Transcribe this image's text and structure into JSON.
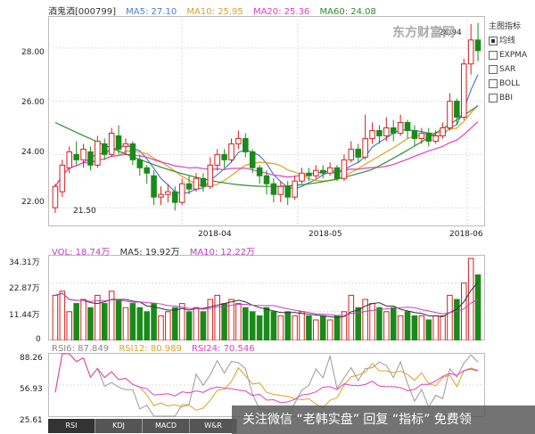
{
  "header": {
    "stock_name": "酒鬼酒[000799]",
    "ma5": "MA5: 27.10",
    "ma10": "MA10: 25.95",
    "ma20": "MA20: 25.36",
    "ma60": "MA60: 24.08"
  },
  "colors": {
    "ma5": "#4a7bd6",
    "ma10": "#e0a020",
    "ma20": "#e040c0",
    "ma60": "#2e8b2e",
    "up": "#d42020",
    "down": "#1a8a1a"
  },
  "price_axis": [
    "28.00",
    "26.00",
    "24.00",
    "22.00"
  ],
  "price_annotations": {
    "high": "28.94",
    "low": "21.50"
  },
  "dates": [
    "2018-04",
    "2018-05",
    "2018-06"
  ],
  "side_menu": {
    "title": "主图指标",
    "items": [
      {
        "label": "均线",
        "checked": true
      },
      {
        "label": "EXPMA",
        "checked": false
      },
      {
        "label": "SAR",
        "checked": false
      },
      {
        "label": "BOLL",
        "checked": false
      },
      {
        "label": "BBI",
        "checked": false
      }
    ]
  },
  "volume": {
    "vol": "VOL: 18.74万",
    "ma5": "MA5: 19.92万",
    "ma10": "MA10: 12.22万",
    "axis": [
      "34.31万",
      "22.87万",
      "11.44万",
      "0"
    ]
  },
  "rsi": {
    "rsi6": "RSI6: 87.849",
    "rsi12": "RSI12: 80.989",
    "rsi24": "RSI24: 70.546",
    "axis": [
      "88.26",
      "56.93",
      "25.61"
    ]
  },
  "tabs": [
    "RSI",
    "KDJ",
    "MACD",
    "W&R"
  ],
  "watermark": {
    "text": "关注微信 “老韩实盘” 回复 “指标” 免费领",
    "logo": "东方财富网"
  },
  "chart_data": {
    "type": "candlestick",
    "candles": [
      [
        22.0,
        22.8,
        21.8,
        22.9
      ],
      [
        22.6,
        23.6,
        22.4,
        23.8
      ],
      [
        23.5,
        24.1,
        23.3,
        24.3
      ],
      [
        24.0,
        23.8,
        23.6,
        24.5
      ],
      [
        23.8,
        24.2,
        23.5,
        24.4
      ],
      [
        24.1,
        23.6,
        23.4,
        24.3
      ],
      [
        23.6,
        24.5,
        23.5,
        24.7
      ],
      [
        24.4,
        24.0,
        23.8,
        24.6
      ],
      [
        24.0,
        24.8,
        23.9,
        25.0
      ],
      [
        24.7,
        24.2,
        24.0,
        25.1
      ],
      [
        24.3,
        24.4,
        24.0,
        24.6
      ],
      [
        24.4,
        23.8,
        23.6,
        24.5
      ],
      [
        23.8,
        23.5,
        23.2,
        24.0
      ],
      [
        23.5,
        23.3,
        22.9,
        23.6
      ],
      [
        23.2,
        22.4,
        22.1,
        23.4
      ],
      [
        22.4,
        22.5,
        22.1,
        22.8
      ],
      [
        22.5,
        22.6,
        22.2,
        22.9
      ],
      [
        22.6,
        22.2,
        21.9,
        22.8
      ],
      [
        22.2,
        22.9,
        22.1,
        23.1
      ],
      [
        22.9,
        22.7,
        22.5,
        23.2
      ],
      [
        22.7,
        23.1,
        22.6,
        23.3
      ],
      [
        23.1,
        22.8,
        22.6,
        23.3
      ],
      [
        22.8,
        23.6,
        22.7,
        23.9
      ],
      [
        23.6,
        24.0,
        23.4,
        24.2
      ],
      [
        24.0,
        23.8,
        23.5,
        24.2
      ],
      [
        23.8,
        24.4,
        23.7,
        24.6
      ],
      [
        24.4,
        24.6,
        24.2,
        24.9
      ],
      [
        24.6,
        24.1,
        23.9,
        24.8
      ],
      [
        24.1,
        23.5,
        23.3,
        24.2
      ],
      [
        23.5,
        23.2,
        22.9,
        23.6
      ],
      [
        23.2,
        22.9,
        22.5,
        23.4
      ],
      [
        22.9,
        22.5,
        22.2,
        23.1
      ],
      [
        22.5,
        22.8,
        22.2,
        23.0
      ],
      [
        22.8,
        22.4,
        22.1,
        23.0
      ],
      [
        22.4,
        23.0,
        22.3,
        23.2
      ],
      [
        23.0,
        23.3,
        22.9,
        23.5
      ],
      [
        23.3,
        23.2,
        23.0,
        23.5
      ],
      [
        23.2,
        23.4,
        23.1,
        23.6
      ],
      [
        23.4,
        23.3,
        23.1,
        23.6
      ],
      [
        23.3,
        23.5,
        23.2,
        23.7
      ],
      [
        23.5,
        23.1,
        23.0,
        23.6
      ],
      [
        23.1,
        23.8,
        23.0,
        24.0
      ],
      [
        23.8,
        24.2,
        23.7,
        24.5
      ],
      [
        24.2,
        23.9,
        23.7,
        24.4
      ],
      [
        23.9,
        24.6,
        23.8,
        25.5
      ],
      [
        24.6,
        24.9,
        24.4,
        25.2
      ],
      [
        24.9,
        24.7,
        24.4,
        25.1
      ],
      [
        24.7,
        25.0,
        24.5,
        25.4
      ],
      [
        25.0,
        24.8,
        24.5,
        25.3
      ],
      [
        24.8,
        25.2,
        24.7,
        25.5
      ],
      [
        25.2,
        24.9,
        24.6,
        25.3
      ],
      [
        24.9,
        24.6,
        24.3,
        25.1
      ],
      [
        24.6,
        24.8,
        24.4,
        25.0
      ],
      [
        24.8,
        24.5,
        24.3,
        25.0
      ],
      [
        24.5,
        24.7,
        24.4,
        24.9
      ],
      [
        24.7,
        25.0,
        24.6,
        25.2
      ],
      [
        25.0,
        26.0,
        24.9,
        26.3
      ],
      [
        26.0,
        25.4,
        25.1,
        26.1
      ],
      [
        25.4,
        27.4,
        25.3,
        27.6
      ],
      [
        27.4,
        28.3,
        27.0,
        28.9
      ],
      [
        28.3,
        27.9,
        27.5,
        28.94
      ]
    ],
    "ylim": [
      21.3,
      29.2
    ],
    "volume": [
      0.55,
      0.6,
      0.35,
      0.45,
      0.5,
      0.4,
      0.55,
      0.45,
      0.6,
      0.5,
      0.4,
      0.45,
      0.4,
      0.35,
      0.45,
      0.3,
      0.35,
      0.4,
      0.45,
      0.35,
      0.4,
      0.35,
      0.5,
      0.55,
      0.45,
      0.5,
      0.45,
      0.4,
      0.35,
      0.3,
      0.4,
      0.35,
      0.3,
      0.35,
      0.3,
      0.35,
      0.3,
      0.25,
      0.3,
      0.25,
      0.3,
      0.35,
      0.55,
      0.4,
      0.5,
      0.45,
      0.4,
      0.35,
      0.4,
      0.3,
      0.35,
      0.3,
      0.3,
      0.25,
      0.3,
      0.3,
      0.55,
      0.5,
      0.7,
      1.0,
      0.8
    ]
  }
}
